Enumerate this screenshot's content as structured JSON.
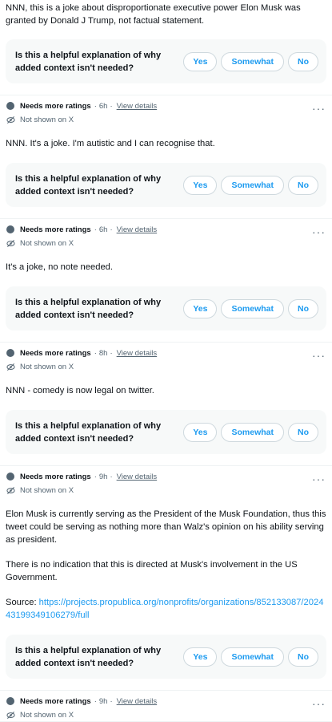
{
  "labels": {
    "needs_more": "Needs more ratings",
    "sep": "·",
    "view_details": "View details",
    "not_shown": "Not shown on X",
    "question": "Is this a helpful explanation of why added context isn't needed?",
    "yes": "Yes",
    "somewhat": "Somewhat",
    "no": "No",
    "more": "···"
  },
  "notes": [
    {
      "time": "",
      "body": [
        "NNN, this is a joke about disproportionate executive power Elon Musk was granted by Donald J Trump, not factual statement."
      ]
    },
    {
      "time": "6h",
      "body": [
        "NNN. It's a joke. I'm autistic and I can recognise that."
      ]
    },
    {
      "time": "6h",
      "body": [
        "It's a joke, no note needed."
      ]
    },
    {
      "time": "8h",
      "body": [
        "NNN - comedy is now legal on twitter."
      ]
    },
    {
      "time": "9h",
      "body": [
        "Elon Musk is currently serving as the President of the Musk Foundation, thus this tweet could be serving as nothing more than Walz's opinion on his ability serving as president.",
        "There is no indication that this is directed at Musk's involvement in the US Government."
      ],
      "source_label": "Source: ",
      "source_url": "https://projects.propublica.org/nonprofits/organizations/852133087/202443199349106279/full"
    },
    {
      "time": "9h",
      "body": []
    }
  ],
  "colors": {
    "accent": "#1d9bf0",
    "text": "#0f1419",
    "muted": "#536471",
    "prompt_bg": "#f7f9f9",
    "border": "#cfd9de"
  }
}
